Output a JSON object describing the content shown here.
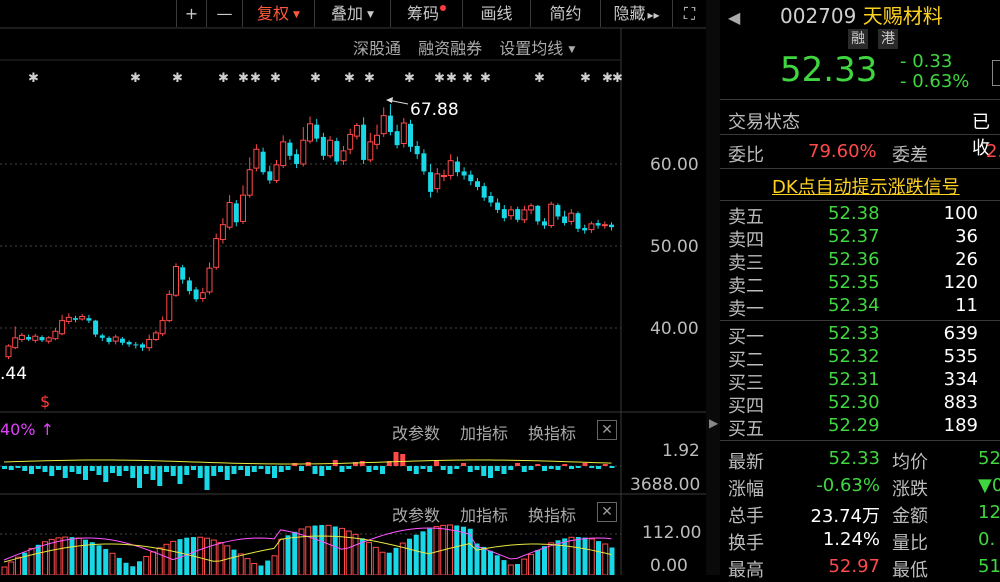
{
  "toolbar": {
    "plus": "+",
    "minus": "—",
    "fuquan": "复权",
    "diejia": "叠加",
    "chouma": "筹码",
    "huaxian": "画线",
    "jianyue": "简约",
    "yincang": "隐藏",
    "more_arrows": "▸▸",
    "fullscreen": "⛶"
  },
  "subbar": {
    "shengutong": "深股通",
    "rongzirongquan": "融资融券",
    "set_ma": "设置均线"
  },
  "chart": {
    "price_ticks": [
      "60.00",
      "50.00",
      "40.00"
    ],
    "high_marker": "67.88",
    "low_marker": ".44",
    "s_marker": "$",
    "flow_pct": "40% ↑",
    "macd_top": "1.92",
    "macd_bottom": "3688.00",
    "vol_top": "112.00",
    "vol_bottom": "0.00",
    "panel_buttons": {
      "gaicanshu": "改参数",
      "jiazhibiao": "加指标",
      "huanzhibiao": "换指标"
    }
  },
  "colors": {
    "up": "#ff4a4a",
    "down": "#18d7e6",
    "green": "#3fd63f",
    "yellow": "#ffd21f"
  },
  "stock": {
    "code": "002709",
    "name": "天赐材料",
    "tag1": "融",
    "tag2": "港",
    "price": "52.33",
    "change": "- 0.33",
    "change_pct": "- 0.63%"
  },
  "status": {
    "label": "交易状态",
    "value": "已收"
  },
  "weibi": {
    "label": "委比",
    "value": "79.60%",
    "label2": "委差",
    "value2": "2."
  },
  "dk_signal": "DK点自动提示涨跌信号",
  "asks": [
    {
      "label": "卖五",
      "price": "52.38",
      "vol": "100"
    },
    {
      "label": "卖四",
      "price": "52.37",
      "vol": "36"
    },
    {
      "label": "卖三",
      "price": "52.36",
      "vol": "26"
    },
    {
      "label": "卖二",
      "price": "52.35",
      "vol": "120"
    },
    {
      "label": "卖一",
      "price": "52.34",
      "vol": "11"
    }
  ],
  "bids": [
    {
      "label": "买一",
      "price": "52.33",
      "vol": "639"
    },
    {
      "label": "买二",
      "price": "52.32",
      "vol": "535"
    },
    {
      "label": "买三",
      "price": "52.31",
      "vol": "334"
    },
    {
      "label": "买四",
      "price": "52.30",
      "vol": "883"
    },
    {
      "label": "买五",
      "price": "52.29",
      "vol": "189"
    }
  ],
  "stats": [
    {
      "l1": "最新",
      "v1": "52.33",
      "l2": "均价",
      "v2": "52"
    },
    {
      "l1": "涨幅",
      "v1": "-0.63%",
      "l2": "涨跌",
      "v2": "▼0"
    },
    {
      "l1": "总手",
      "v1": "23.74万",
      "l2": "金额",
      "v2": "12.4"
    },
    {
      "l1": "换手",
      "v1": "1.24%",
      "l2": "量比",
      "v2": "0."
    },
    {
      "l1": "最高",
      "v1": "52.97",
      "l2": "最低",
      "v2": "51"
    }
  ]
}
